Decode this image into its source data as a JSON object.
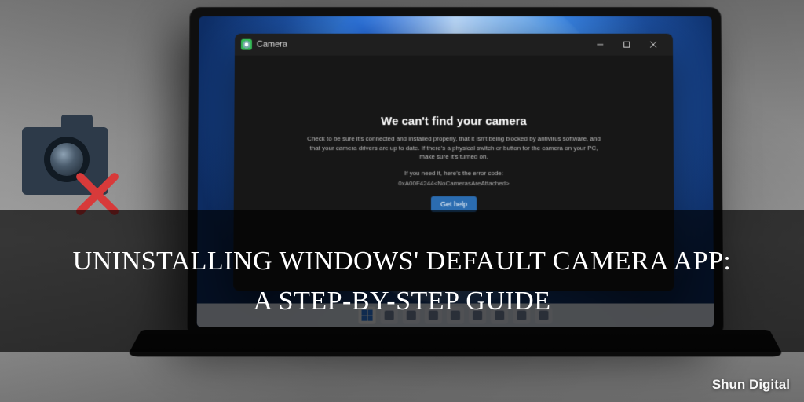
{
  "card": {
    "title_line1": "UNINSTALLING WINDOWS' DEFAULT CAMERA APP:",
    "title_line2": "A STEP-BY-STEP GUIDE",
    "watermark": "Shun Digital"
  },
  "camera_app": {
    "window_title": "Camera",
    "error_heading": "We can't find your camera",
    "error_body": "Check to be sure it's connected and installed properly, that it isn't being blocked by antivirus software, and that your camera drivers are up to date. If there's a physical switch or button for the camera on your PC, make sure it's turned on.",
    "hint": "If you need it, here's the error code:",
    "error_code": "0xA00F4244<NoCamerasAreAttached>",
    "help_button": "Get help"
  },
  "taskbar": {
    "items": [
      "start",
      "search",
      "task-view",
      "widgets",
      "chat",
      "explorer",
      "edge",
      "store",
      "camera"
    ]
  },
  "colors": {
    "overlay_band": "rgba(0,0,0,0.66)",
    "delete_x": "#d83a3a",
    "camera_icon_body": "#2d3a49",
    "win_accent": "#2f7fe6"
  }
}
